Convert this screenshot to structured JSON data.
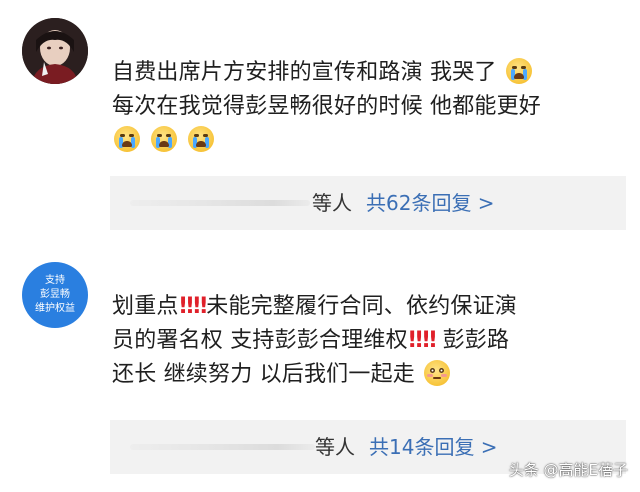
{
  "comments": [
    {
      "avatar": "user-photo",
      "lines": [
        {
          "before": "自费出席片方安排的宣传和路演 我哭了",
          "emojis": [
            "crying-face-icon"
          ]
        },
        {
          "before": "每次在我觉得彭昱畅很好的时候 他都能更好"
        },
        {
          "emojis": [
            "crying-face-icon",
            "crying-face-icon",
            "crying-face-icon"
          ]
        }
      ],
      "reply": {
        "suffix": "等人",
        "count_text": "共62条回复 >"
      }
    },
    {
      "avatar_badge": [
        "支持",
        "彭昱畅",
        "维护权益"
      ],
      "lines": [
        {
          "a": "划重点",
          "b": "未能完整履行合同、依约保证演"
        },
        {
          "a": "员的署名权 支持彭彭合理维权",
          "b": "彭彭路"
        },
        {
          "a": "还长 继续努力 以后我们一起走"
        }
      ],
      "reply": {
        "suffix": "等人",
        "count_text": "共14条回复 >"
      }
    }
  ],
  "exclaim": "‼",
  "watermark": "头条 @高能E蓓子",
  "colors": {
    "link": "#3b6fb5",
    "badge": "#2a7fe0",
    "exclaim": "#e0202a",
    "reply_bg": "#f2f2f2"
  }
}
